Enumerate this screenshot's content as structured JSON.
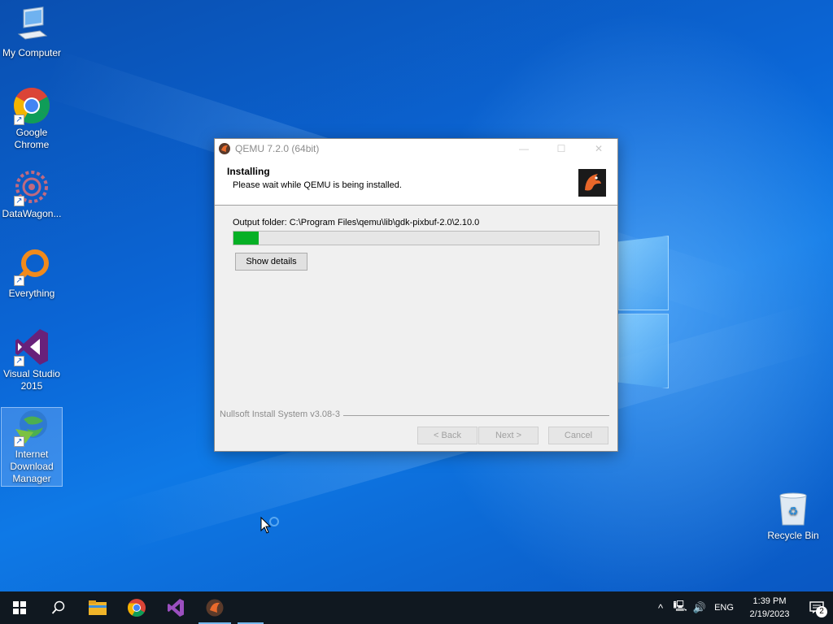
{
  "desktop": {
    "icons": [
      {
        "label": "My Computer",
        "icon": "computer-icon"
      },
      {
        "label": "Google Chrome",
        "icon": "chrome-icon"
      },
      {
        "label": "DataWagon...",
        "icon": "datawagon-icon"
      },
      {
        "label": "Everything",
        "icon": "everything-search-icon"
      },
      {
        "label": "Visual Studio 2015",
        "icon": "visual-studio-icon"
      },
      {
        "label": "Internet Download Manager",
        "icon": "idm-icon"
      },
      {
        "label": "Recycle Bin",
        "icon": "recycle-bin-icon"
      }
    ]
  },
  "window": {
    "title": "QEMU 7.2.0 (64bit)",
    "header_title": "Installing",
    "header_subtitle": "Please wait while QEMU is being installed.",
    "output_folder": "Output folder: C:\\Program Files\\qemu\\lib\\gdk-pixbuf-2.0\\2.10.0",
    "progress_percent": 7,
    "show_details_label": "Show details",
    "branding": "Nullsoft Install System v3.08-3",
    "back_label": "< Back",
    "next_label": "Next >",
    "cancel_label": "Cancel",
    "controls": {
      "minimize": "—",
      "maximize": "☐",
      "close": "✕"
    }
  },
  "taskbar": {
    "apps": [
      "start-icon",
      "search-icon",
      "file-explorer-icon",
      "chrome-icon",
      "visual-studio-icon",
      "qemu-icon"
    ],
    "language": "ENG",
    "time": "1:39 PM",
    "date": "2/19/2023",
    "notification_count": "2"
  },
  "colors": {
    "progress_fill": "#06b025",
    "taskbar": "#101820",
    "accent": "#76b9ed"
  }
}
